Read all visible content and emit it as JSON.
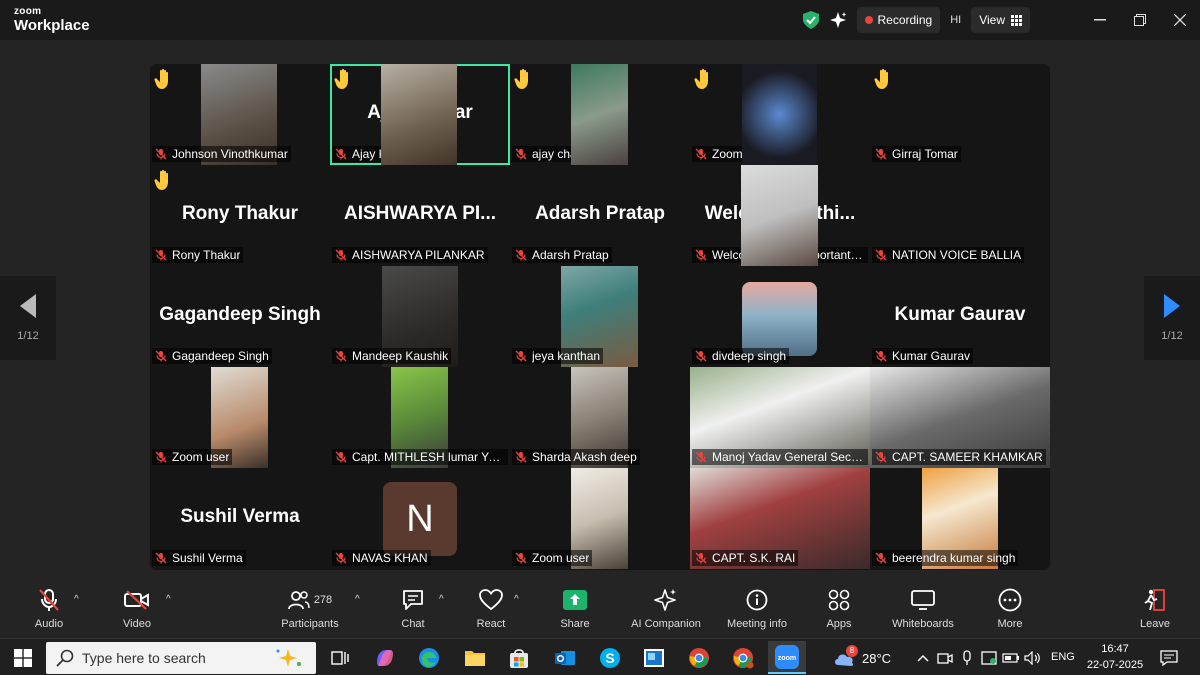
{
  "app": {
    "brand_small": "zoom",
    "brand_big": "Workplace"
  },
  "header": {
    "recording_label": "Recording",
    "user_initials": "HI",
    "view_label": "View"
  },
  "gallery": {
    "page_indicator": "1/12",
    "tiles": [
      {
        "label": "Johnson Vinothkumar",
        "big": "",
        "hand": true
      },
      {
        "label": "Ajay Kumar",
        "big": "Ajay Kumar",
        "hand": true,
        "active": true
      },
      {
        "label": "ajay chaudhary",
        "big": "",
        "hand": true
      },
      {
        "label": "Zoom user",
        "big": "",
        "hand": true
      },
      {
        "label": "Girraj Tomar",
        "big": "",
        "hand": true
      },
      {
        "label": "Rony Thakur",
        "big": "Rony Thakur",
        "hand": true
      },
      {
        "label": "AISHWARYA PILANKAR",
        "big": "AISHWARYA PI...",
        "hand": false
      },
      {
        "label": "Adarsh Pratap",
        "big": "Adarsh Pratap",
        "hand": false
      },
      {
        "label": "Welcome to this important d...",
        "big": "Welcome to thi...",
        "hand": false
      },
      {
        "label": "NATION VOICE BALLIA",
        "big": "",
        "hand": false
      },
      {
        "label": "Gagandeep Singh",
        "big": "Gagandeep Singh",
        "hand": false
      },
      {
        "label": "Mandeep Kaushik",
        "big": "",
        "hand": false
      },
      {
        "label": "jeya kanthan",
        "big": "",
        "hand": false
      },
      {
        "label": "divdeep singh",
        "big": "",
        "hand": false
      },
      {
        "label": "Kumar Gaurav",
        "big": "Kumar Gaurav",
        "hand": false
      },
      {
        "label": "Zoom user",
        "big": "",
        "hand": false
      },
      {
        "label": "Capt. MITHLESH lumar Yadav",
        "big": "",
        "hand": false
      },
      {
        "label": "Sharda Akash deep",
        "big": "",
        "hand": false
      },
      {
        "label": "Manoj Yadav General Secretary...",
        "big": "",
        "hand": false
      },
      {
        "label": "CAPT. SAMEER KHAMKAR",
        "big": "",
        "hand": false
      },
      {
        "label": "Sushil Verma",
        "big": "Sushil Verma",
        "hand": false
      },
      {
        "label": "NAVAS KHAN",
        "big": "",
        "hand": false,
        "avatar_letter": "N"
      },
      {
        "label": "Zoom user",
        "big": "",
        "hand": false
      },
      {
        "label": "CAPT. S.K. RAI",
        "big": "",
        "hand": false
      },
      {
        "label": "beerendra kumar singh",
        "big": "",
        "hand": false
      }
    ]
  },
  "toolbar": {
    "audio": "Audio",
    "video": "Video",
    "participants": "Participants",
    "participants_count": "278",
    "chat": "Chat",
    "react": "React",
    "share": "Share",
    "ai_companion": "AI Companion",
    "meeting_info": "Meeting info",
    "apps": "Apps",
    "whiteboards": "Whiteboards",
    "more": "More",
    "leave": "Leave"
  },
  "taskbar": {
    "search_placeholder": "Type here to search",
    "weather": "28°C",
    "weather_badge": "8",
    "language": "ENG",
    "time": "16:47",
    "date": "22-07-2025",
    "zoom_label": "zoom"
  },
  "colors": {
    "active_border": "#3ce8a4",
    "recording": "#e8453c",
    "share_green": "#1bb46a",
    "accent_blue": "#2d8cff",
    "hand": "#ffc83d"
  }
}
